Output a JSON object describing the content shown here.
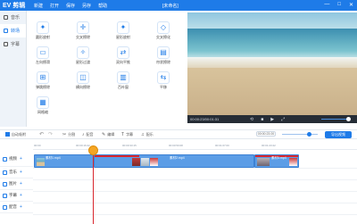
{
  "titlebar": {
    "app_name": "EV 剪辑",
    "menu": [
      "新建",
      "打开",
      "保存",
      "另存",
      "帮助"
    ],
    "doc_title": "[未命名]",
    "controls": [
      "—",
      "□",
      "✕"
    ]
  },
  "leftnav": {
    "items": [
      {
        "label": "音乐",
        "icon": "music-icon",
        "active": false
      },
      {
        "label": "转场",
        "icon": "transition-icon",
        "active": true
      },
      {
        "label": "字幕",
        "icon": "text-icon",
        "active": false
      }
    ]
  },
  "effects": [
    {
      "label": "圆形放射",
      "glyph": "✦"
    },
    {
      "label": "交叉擦除",
      "glyph": "✛"
    },
    {
      "label": "星形放射",
      "glyph": "✦"
    },
    {
      "label": "交叉擦化",
      "glyph": "◇"
    },
    {
      "label": "左向擦滑",
      "glyph": "▭"
    },
    {
      "label": "星形过渡",
      "glyph": "✧"
    },
    {
      "label": "双向平推",
      "glyph": "⇄"
    },
    {
      "label": "帘状擦除",
      "glyph": "▤"
    },
    {
      "label": "弹跳擦除",
      "glyph": "⊞"
    },
    {
      "label": "横向擦除",
      "glyph": "◫"
    },
    {
      "label": "百叶窗",
      "glyph": "▥"
    },
    {
      "label": "平移",
      "glyph": "⇆"
    },
    {
      "label": "网格缩",
      "glyph": "▦"
    }
  ],
  "player": {
    "time": "00:00:23/00:01:31",
    "buttons": [
      "⟲",
      "■",
      "▶",
      "⤢"
    ]
  },
  "toolbar": {
    "auto_snap": "自动吸附",
    "undo": "↶",
    "redo": "↷",
    "split": "分割",
    "dub": "配音",
    "edit": "编辑",
    "subtitle": "字幕",
    "watermark": "配乐",
    "timecode": "00:00:23.00",
    "export": "导出视频"
  },
  "ruler": [
    "00:00",
    "00:00:16:22",
    "00:00:33:15",
    "00:00:50:08",
    "00:01:07:00",
    "00:01:23:22"
  ],
  "tracks": [
    {
      "label": "视频",
      "plus": "+"
    },
    {
      "label": "音乐",
      "plus": "+"
    },
    {
      "label": "图片",
      "plus": "+"
    },
    {
      "label": "字幕",
      "plus": "+"
    },
    {
      "label": "配音",
      "plus": "+"
    }
  ],
  "clips": {
    "clip1_label": "素材1.mp4",
    "clip2_label": "素材2.mp4",
    "clip3_label": "素材3.mp4"
  },
  "colors": {
    "brand": "#1e7be8",
    "playhead": "#d9272e",
    "clip": "#5b9de6"
  }
}
